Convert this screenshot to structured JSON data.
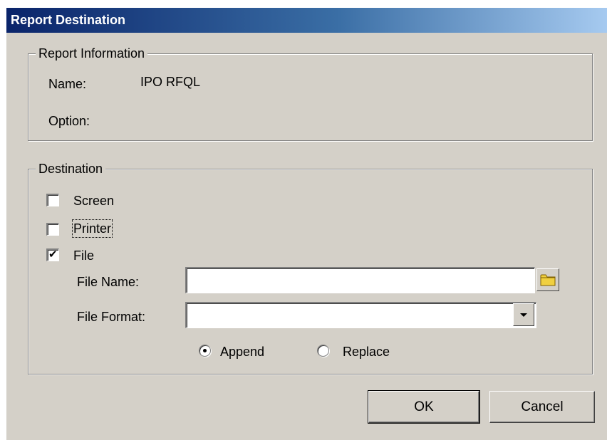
{
  "window": {
    "title": "Report Destination"
  },
  "report_info": {
    "legend": "Report Information",
    "name_label": "Name:",
    "name_value": "IPO RFQL",
    "option_label": "Option:",
    "option_value": ""
  },
  "destination": {
    "legend": "Destination",
    "screen": {
      "label": "Screen",
      "checked": false
    },
    "printer": {
      "label": "Printer",
      "checked": false
    },
    "file": {
      "label": "File",
      "checked": true
    },
    "file_name_label": "File Name:",
    "file_name_value": "",
    "file_format_label": "File Format:",
    "file_format_value": "",
    "append_label": "Append",
    "replace_label": "Replace",
    "selected_mode": "Append"
  },
  "buttons": {
    "ok": "OK",
    "cancel": "Cancel"
  },
  "icons": {
    "browse": "folder-icon",
    "dropdown": "chevron-down-icon"
  },
  "colors": {
    "window_bg": "#d4d0c8",
    "title_start": "#0a246a",
    "title_end": "#a6caf0",
    "folder": "#f0d040"
  }
}
